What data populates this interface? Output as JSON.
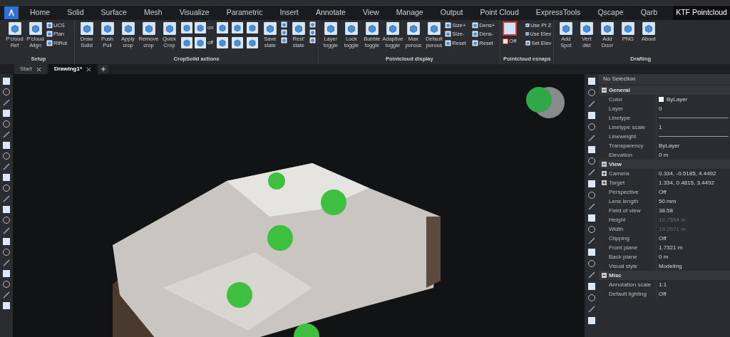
{
  "ribbon_tabs": [
    {
      "label": "Home",
      "selected": false
    },
    {
      "label": "Solid",
      "selected": false
    },
    {
      "label": "Surface",
      "selected": false
    },
    {
      "label": "Mesh",
      "selected": false
    },
    {
      "label": "Visualize",
      "selected": false
    },
    {
      "label": "Parametric",
      "selected": false
    },
    {
      "label": "Insert",
      "selected": false
    },
    {
      "label": "Annotate",
      "selected": false
    },
    {
      "label": "View",
      "selected": false
    },
    {
      "label": "Manage",
      "selected": false
    },
    {
      "label": "Output",
      "selected": false
    },
    {
      "label": "Point Cloud",
      "selected": false
    },
    {
      "label": "ExpressTools",
      "selected": false
    },
    {
      "label": "Qscape",
      "selected": false
    },
    {
      "label": "Qarb",
      "selected": false
    },
    {
      "label": "KTF Pointcloud",
      "selected": true
    }
  ],
  "ribbon_groups": [
    {
      "title": "Setup",
      "items": [
        {
          "kind": "large",
          "label": "P'cloud Ref"
        },
        {
          "kind": "large",
          "label": "P'cloud Align"
        },
        {
          "kind": "stack",
          "items": [
            "UCS",
            "Plan",
            "RtRot"
          ]
        }
      ]
    },
    {
      "title": "CropSolid actions",
      "items": [
        {
          "kind": "large",
          "label": "Draw Solid"
        },
        {
          "kind": "large",
          "label": "Push Pull"
        },
        {
          "kind": "large",
          "label": "Apply crop"
        },
        {
          "kind": "large",
          "label": "Remove crop"
        },
        {
          "kind": "large",
          "label": "Quick Crop"
        },
        {
          "kind": "pair",
          "items": [
            "on",
            "off"
          ]
        },
        {
          "kind": "grid"
        },
        {
          "kind": "large",
          "label": "Save state"
        },
        {
          "kind": "minis"
        },
        {
          "kind": "large",
          "label": "Rest' state"
        },
        {
          "kind": "minis"
        }
      ]
    },
    {
      "title": "Pointcloud display",
      "items": [
        {
          "kind": "large",
          "label": "Layer toggle"
        },
        {
          "kind": "large",
          "label": "Lock toggle"
        },
        {
          "kind": "large",
          "label": "Bubble toggle"
        },
        {
          "kind": "large",
          "label": "Adaptive toggle"
        },
        {
          "kind": "large",
          "label": "Max porous"
        },
        {
          "kind": "large",
          "label": "Default porous"
        },
        {
          "kind": "stack",
          "items": [
            "Size+",
            "Size-",
            "Reset"
          ]
        },
        {
          "kind": "stack",
          "items": [
            "Dens+",
            "Dens-",
            "Reset"
          ]
        }
      ]
    },
    {
      "title": "Pointcloud esnaps",
      "items": [
        {
          "kind": "toggle",
          "label": "Off"
        },
        {
          "kind": "stack",
          "items": [
            "Use Pt Z",
            "Use Elev",
            "Set Elev"
          ]
        }
      ]
    },
    {
      "title": "Drafting",
      "items": [
        {
          "kind": "large",
          "label": "Add Spot"
        },
        {
          "kind": "large",
          "label": "Vert dist"
        },
        {
          "kind": "large",
          "label": "Add Door"
        },
        {
          "kind": "large",
          "label": "PNG"
        },
        {
          "kind": "large",
          "label": "About"
        }
      ]
    }
  ],
  "doc_tabs": [
    {
      "label": "Start",
      "selected": false
    },
    {
      "label": "Drawing1*",
      "selected": true
    }
  ],
  "properties": {
    "title": "No Selection",
    "rows": [
      {
        "kind": "section",
        "label": "General"
      },
      {
        "kind": "color",
        "label": "Color",
        "value": "ByLayer"
      },
      {
        "kind": "text",
        "label": "Layer",
        "value": "0"
      },
      {
        "kind": "line",
        "label": "Linetype"
      },
      {
        "kind": "text",
        "label": "Linetype scale",
        "value": "1"
      },
      {
        "kind": "line",
        "label": "Lineweight"
      },
      {
        "kind": "text",
        "label": "Transparency",
        "value": "ByLayer"
      },
      {
        "kind": "text",
        "label": "Elevation",
        "value": "0 m"
      },
      {
        "kind": "section",
        "label": "View"
      },
      {
        "kind": "group",
        "label": "Camera",
        "value": "0.334, -0.5185, 4.4492"
      },
      {
        "kind": "group",
        "label": "Target",
        "value": "1.334, 0.4815, 3.4492"
      },
      {
        "kind": "text",
        "label": "Perspective",
        "value": "Off"
      },
      {
        "kind": "text",
        "label": "Lens length",
        "value": "50 mm"
      },
      {
        "kind": "text",
        "label": "Field of view",
        "value": "38.58"
      },
      {
        "kind": "readonly",
        "label": "Height",
        "value": "10.7554 m"
      },
      {
        "kind": "readonly",
        "label": "Width",
        "value": "19.2071 m"
      },
      {
        "kind": "text",
        "label": "Clipping",
        "value": "Off"
      },
      {
        "kind": "text",
        "label": "Front plane",
        "value": "1.7321 m"
      },
      {
        "kind": "text",
        "label": "Back plane",
        "value": "0 m"
      },
      {
        "kind": "text",
        "label": "Visual style",
        "value": "Modeling"
      },
      {
        "kind": "section",
        "label": "Misc"
      },
      {
        "kind": "text",
        "label": "Annotation scale",
        "value": "1:1"
      },
      {
        "kind": "text",
        "label": "Default lighting",
        "value": "Off"
      }
    ]
  }
}
